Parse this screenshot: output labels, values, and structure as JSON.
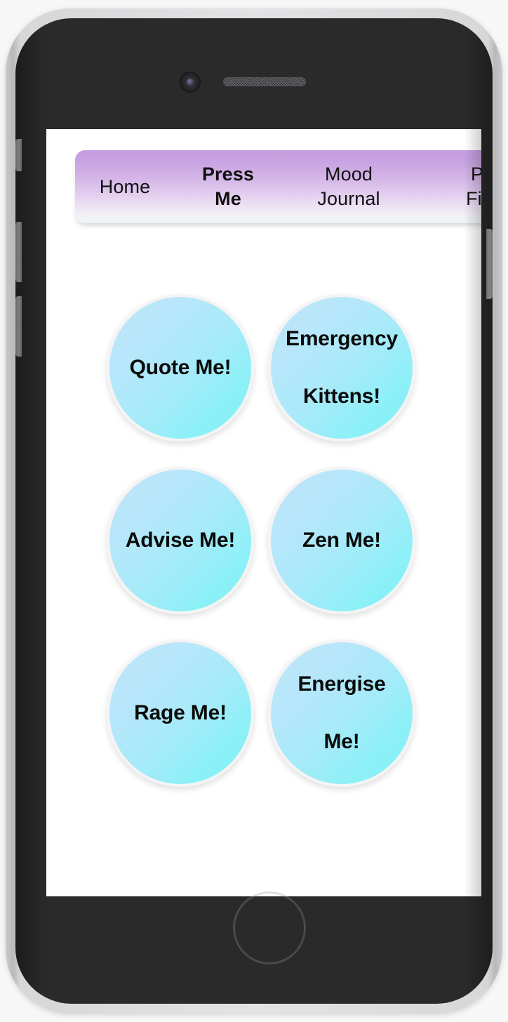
{
  "device": {
    "type": "smartphone-mockup",
    "frame_color": "#e3e3e5",
    "body_color": "#2a2a2b",
    "hardware": {
      "front_camera": "front-camera",
      "earpiece_speaker": "earpiece-speaker",
      "home_button": "home-button",
      "silent_switch": "silent-switch-button",
      "volume_up": "volume-up-button",
      "volume_down": "volume-down-button",
      "power": "power-button"
    }
  },
  "screen": {
    "background": "#ffffff"
  },
  "nav": {
    "accent_top": "#c79ee0",
    "accent_bottom": "#eef4f8",
    "active_index": 1,
    "items": [
      {
        "label": "Home",
        "active": false
      },
      {
        "label": "Press\nMe",
        "active": true
      },
      {
        "label": "Mood\nJournal",
        "active": false
      },
      {
        "label": "P\nFir",
        "active": false
      }
    ]
  },
  "main": {
    "button_color_start": "#bfe6fa",
    "button_color_end": "#7ef2f6",
    "buttons": [
      {
        "label": "Quote Me!",
        "lines": 1
      },
      {
        "label": "Emergency\nKittens!",
        "lines": 2
      },
      {
        "label": "Advise Me!",
        "lines": 1
      },
      {
        "label": "Zen Me!",
        "lines": 1
      },
      {
        "label": "Rage Me!",
        "lines": 1
      },
      {
        "label": "Energise\nMe!",
        "lines": 2
      }
    ]
  }
}
